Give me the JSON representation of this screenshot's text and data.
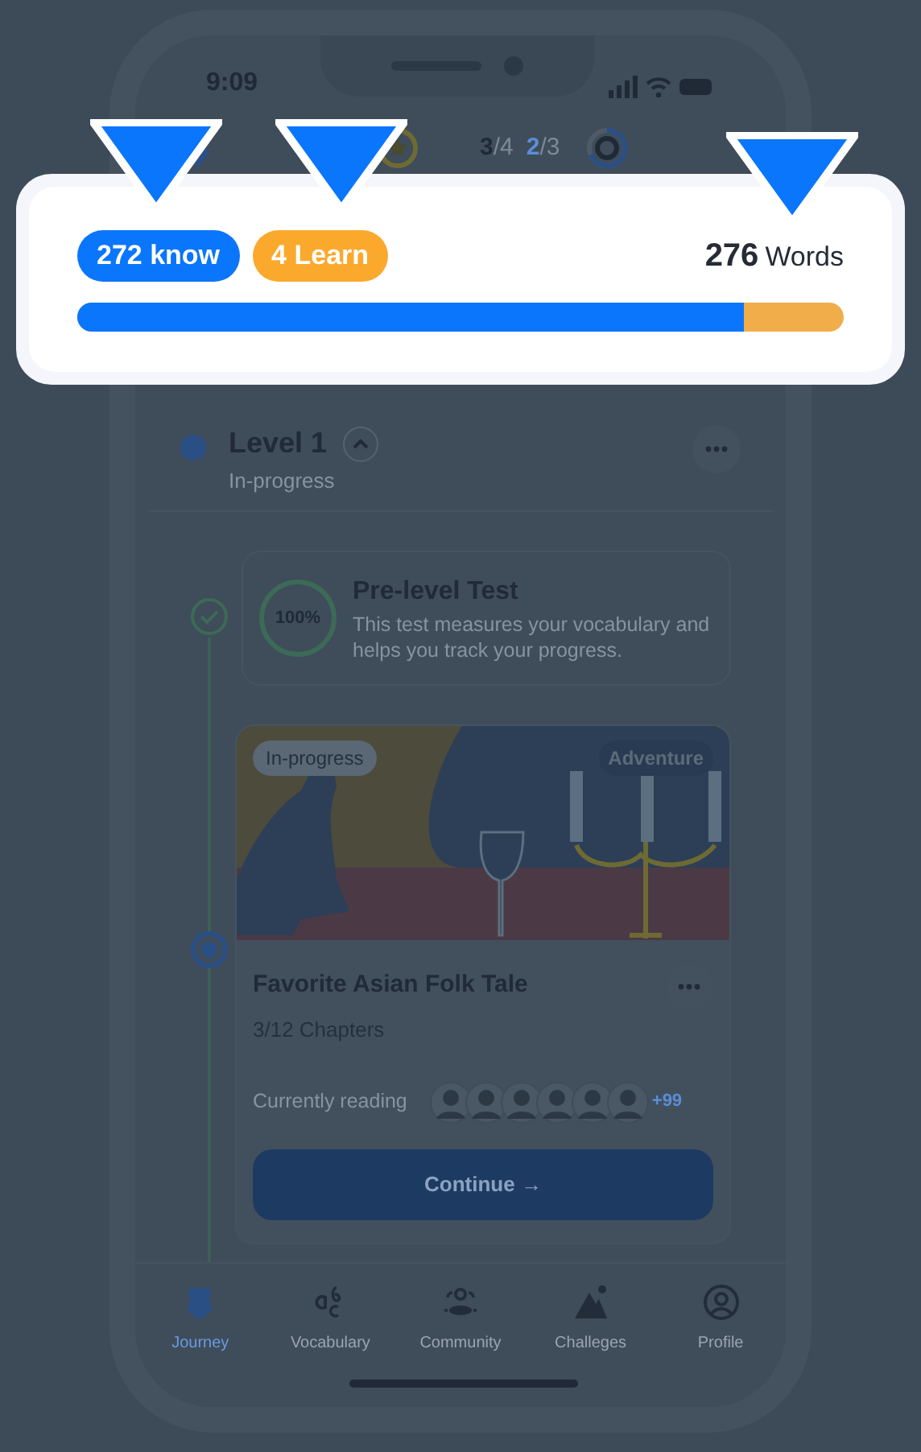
{
  "status_bar": {
    "time": "9:09"
  },
  "header": {
    "stats": [
      {
        "done": "3",
        "total": "/4",
        "kind": "dark"
      },
      {
        "done": "2",
        "total": "/3",
        "kind": "blue"
      }
    ]
  },
  "callout": {
    "known": "272 know",
    "learn": "4 Learn",
    "total_number": "276",
    "total_label": "Words",
    "level": 0.87
  },
  "level": {
    "title": "Level 1",
    "status": "In-progress",
    "expanded": true
  },
  "pre_test": {
    "score": "100%",
    "title": "Pre-level Test",
    "description": "This test measures your vocabulary and helps you track your progress.",
    "done": true
  },
  "story": {
    "status": "In-progress",
    "genre": "Adventure",
    "title": "Favorite Asian Folk Tale",
    "chapters": "3/12 Chapters",
    "reading_label": "Currently reading",
    "extra_readers": "+99",
    "button": "Continue →"
  },
  "tabs": [
    {
      "label": "Journey",
      "selected": true,
      "kind": "journey"
    },
    {
      "label": "Vocabulary",
      "selected": false,
      "kind": "vocab"
    },
    {
      "label": "Community",
      "selected": false,
      "kind": "community"
    },
    {
      "label": "Challeges",
      "selected": false,
      "kind": "challenge"
    },
    {
      "label": "Profile",
      "selected": false,
      "kind": "profile"
    }
  ]
}
